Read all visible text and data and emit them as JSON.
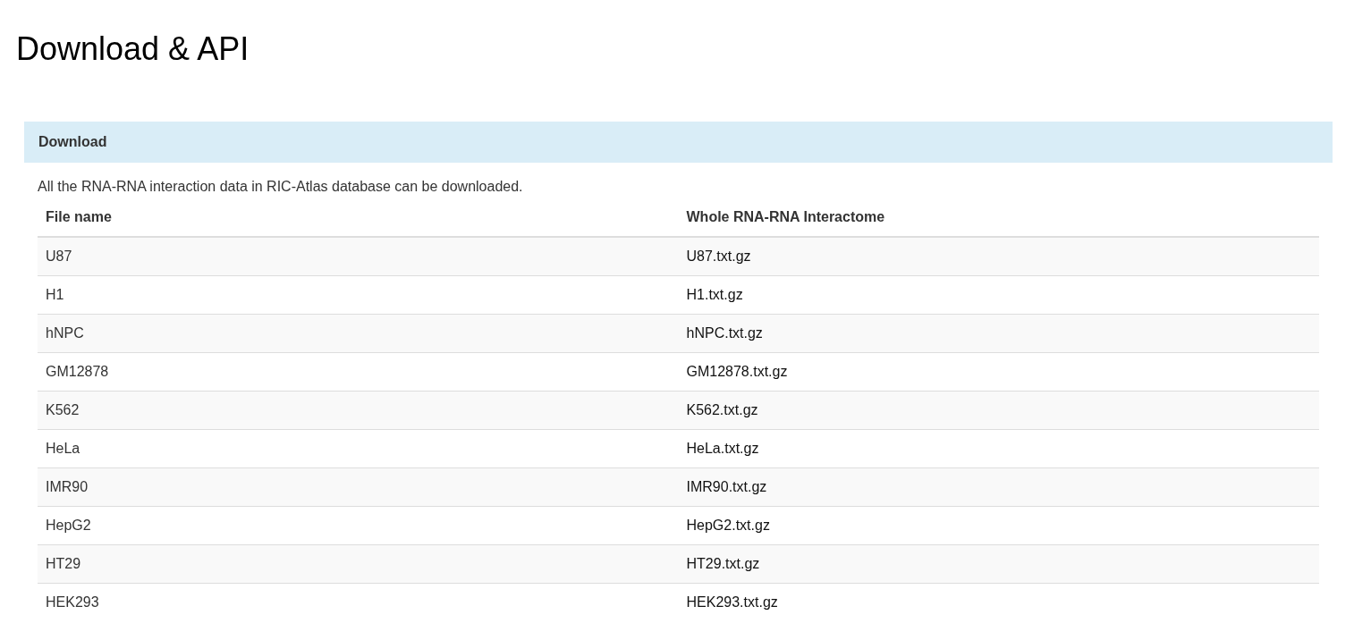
{
  "page": {
    "title": "Download & API"
  },
  "panel": {
    "heading": "Download",
    "description": "All the RNA-RNA interaction data in RIC-Atlas database can be downloaded."
  },
  "table": {
    "columns": [
      "File name",
      "Whole RNA-RNA Interactome"
    ],
    "rows": [
      {
        "name": "U87",
        "file": "U87.txt.gz"
      },
      {
        "name": "H1",
        "file": "H1.txt.gz"
      },
      {
        "name": "hNPC",
        "file": "hNPC.txt.gz"
      },
      {
        "name": "GM12878",
        "file": "GM12878.txt.gz"
      },
      {
        "name": "K562",
        "file": "K562.txt.gz"
      },
      {
        "name": "HeLa",
        "file": "HeLa.txt.gz"
      },
      {
        "name": "IMR90",
        "file": "IMR90.txt.gz"
      },
      {
        "name": "HepG2",
        "file": "HepG2.txt.gz"
      },
      {
        "name": "HT29",
        "file": "HT29.txt.gz"
      },
      {
        "name": "HEK293",
        "file": "HEK293.txt.gz"
      }
    ]
  }
}
